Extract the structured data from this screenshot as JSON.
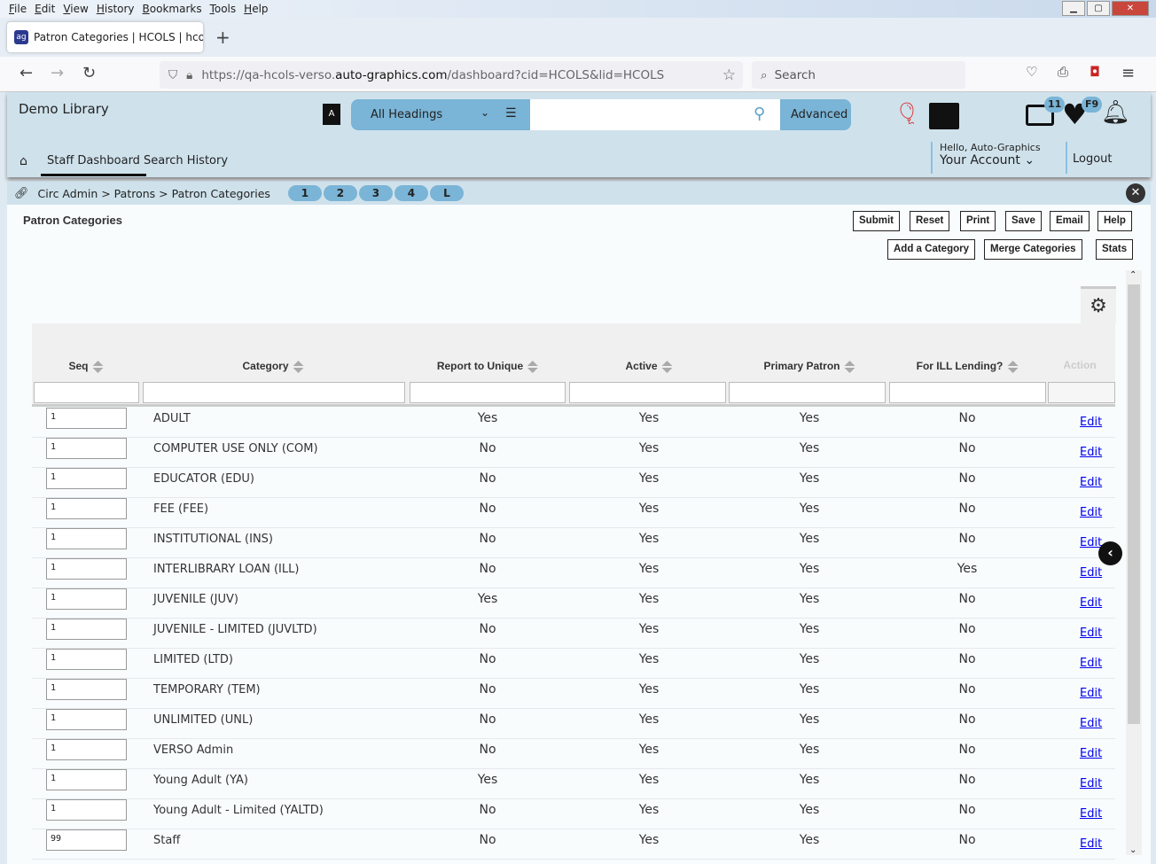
{
  "browser": {
    "menu": [
      "File",
      "Edit",
      "View",
      "History",
      "Bookmarks",
      "Tools",
      "Help"
    ],
    "tab_title": "Patron Categories | HCOLS | hco",
    "url_prefix": "https://qa-hcols-verso.",
    "url_domain": "auto-graphics.com",
    "url_rest": "/dashboard?cid=HCOLS&lid=HCOLS",
    "search_placeholder": "Search"
  },
  "header": {
    "library": "Demo Library",
    "search_scope": "All Headings",
    "advanced": "Advanced",
    "list_badge": "11",
    "fav_badge": "F9",
    "hello": "Hello, Auto-Graphics",
    "account": "Your Account",
    "logout": "Logout",
    "nav": [
      "Staff Dashboard",
      "Search History"
    ]
  },
  "breadcrumb": {
    "path": "Circ Admin > Patrons > Patron Categories",
    "pills": [
      "1",
      "2",
      "3",
      "4",
      "L"
    ]
  },
  "page": {
    "title": "Patron Categories",
    "buttons": [
      "Submit",
      "Reset",
      "Print",
      "Save",
      "Email",
      "Help"
    ],
    "buttons2": [
      "Add a Category",
      "Merge Categories",
      "Stats"
    ]
  },
  "table": {
    "columns": [
      "Seq",
      "Category",
      "Report to Unique",
      "Active",
      "Primary Patron",
      "For ILL Lending?",
      "Action"
    ],
    "edit_label": "Edit",
    "rows": [
      [
        "1",
        "ADULT",
        "Yes",
        "Yes",
        "Yes",
        "No"
      ],
      [
        "1",
        "COMPUTER USE ONLY (COM)",
        "No",
        "Yes",
        "Yes",
        "No"
      ],
      [
        "1",
        "EDUCATOR (EDU)",
        "No",
        "Yes",
        "Yes",
        "No"
      ],
      [
        "1",
        "FEE (FEE)",
        "No",
        "Yes",
        "Yes",
        "No"
      ],
      [
        "1",
        "INSTITUTIONAL (INS)",
        "No",
        "Yes",
        "Yes",
        "No"
      ],
      [
        "1",
        "INTERLIBRARY LOAN (ILL)",
        "No",
        "Yes",
        "Yes",
        "Yes"
      ],
      [
        "1",
        "JUVENILE (JUV)",
        "Yes",
        "Yes",
        "Yes",
        "No"
      ],
      [
        "1",
        "JUVENILE - LIMITED (JUVLTD)",
        "No",
        "Yes",
        "Yes",
        "No"
      ],
      [
        "1",
        "LIMITED (LTD)",
        "No",
        "Yes",
        "Yes",
        "No"
      ],
      [
        "1",
        "TEMPORARY (TEM)",
        "No",
        "Yes",
        "Yes",
        "No"
      ],
      [
        "1",
        "UNLIMITED (UNL)",
        "No",
        "Yes",
        "Yes",
        "No"
      ],
      [
        "1",
        "VERSO Admin",
        "No",
        "Yes",
        "Yes",
        "No"
      ],
      [
        "1",
        "Young Adult (YA)",
        "Yes",
        "Yes",
        "Yes",
        "No"
      ],
      [
        "1",
        "Young Adult - Limited (YALTD)",
        "No",
        "Yes",
        "Yes",
        "No"
      ],
      [
        "99",
        "Staff",
        "No",
        "Yes",
        "Yes",
        "No"
      ]
    ]
  }
}
